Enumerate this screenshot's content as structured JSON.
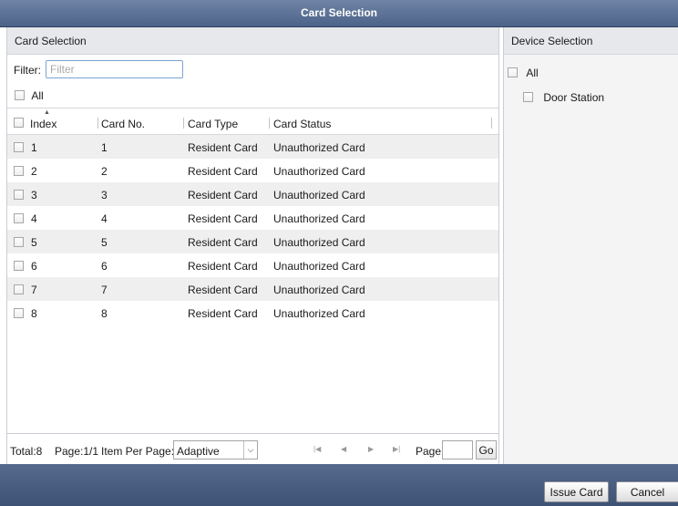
{
  "window": {
    "title": "Card Selection"
  },
  "card_panel": {
    "header": "Card Selection",
    "filter": {
      "label": "Filter:",
      "placeholder": "Filter",
      "value": ""
    },
    "all_label": "All",
    "columns": [
      "Index",
      "Card No.",
      "Card Type",
      "Card Status"
    ],
    "rows": [
      {
        "index": "1",
        "card_no": "1",
        "card_type": "Resident Card",
        "card_status": "Unauthorized Card"
      },
      {
        "index": "2",
        "card_no": "2",
        "card_type": "Resident Card",
        "card_status": "Unauthorized Card"
      },
      {
        "index": "3",
        "card_no": "3",
        "card_type": "Resident Card",
        "card_status": "Unauthorized Card"
      },
      {
        "index": "4",
        "card_no": "4",
        "card_type": "Resident Card",
        "card_status": "Unauthorized Card"
      },
      {
        "index": "5",
        "card_no": "5",
        "card_type": "Resident Card",
        "card_status": "Unauthorized Card"
      },
      {
        "index": "6",
        "card_no": "6",
        "card_type": "Resident Card",
        "card_status": "Unauthorized Card"
      },
      {
        "index": "7",
        "card_no": "7",
        "card_type": "Resident Card",
        "card_status": "Unauthorized Card"
      },
      {
        "index": "8",
        "card_no": "8",
        "card_type": "Resident Card",
        "card_status": "Unauthorized Card"
      }
    ],
    "pager": {
      "total": "Total:8",
      "page": "Page:1/1",
      "items_per_page_label": "Item Per Page:",
      "items_per_page_value": "Adaptive",
      "page_label": "Page",
      "page_input": "",
      "go_label": "Go"
    }
  },
  "device_panel": {
    "header": "Device Selection",
    "all_label": "All",
    "devices": [
      "Door Station"
    ]
  },
  "footer": {
    "issue_label": "Issue Card",
    "cancel_label": "Cancel"
  },
  "icons": {
    "sort": "sort-ascending-icon",
    "first": "first-page-icon",
    "prev": "previous-page-icon",
    "next": "next-page-icon",
    "last": "last-page-icon",
    "dropdown": "chevron-down-icon"
  },
  "colors": {
    "title_bar": "#4c6389",
    "panel_header": "#e6e8ec",
    "row_alt": "#efefef",
    "focus_border": "#7aa3d4"
  }
}
